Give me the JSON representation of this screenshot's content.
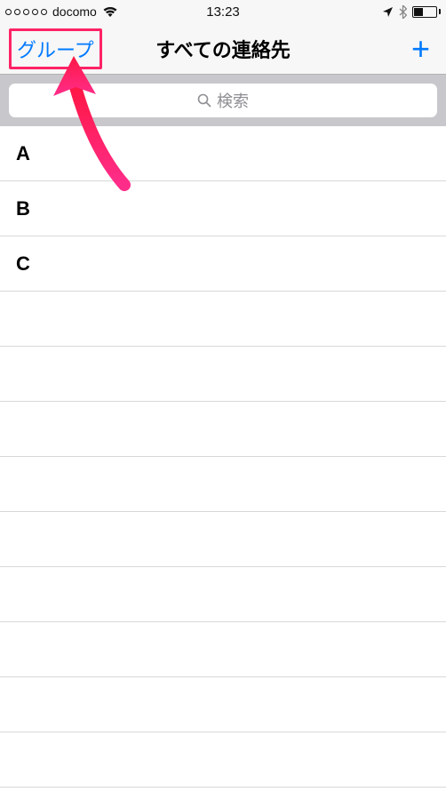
{
  "status": {
    "carrier": "docomo",
    "time": "13:23"
  },
  "nav": {
    "left_label": "グループ",
    "title": "すべての連絡先",
    "add_label": "+"
  },
  "search": {
    "placeholder": "検索"
  },
  "contacts": {
    "sections": [
      {
        "letter": "A"
      },
      {
        "letter": "B"
      },
      {
        "letter": "C"
      }
    ]
  }
}
